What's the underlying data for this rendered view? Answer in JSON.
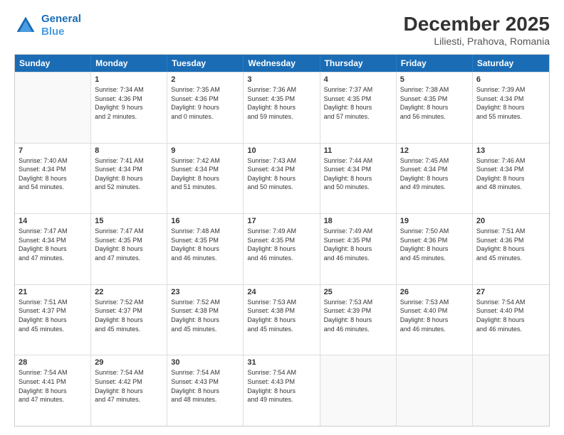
{
  "header": {
    "logo_line1": "General",
    "logo_line2": "Blue",
    "main_title": "December 2025",
    "subtitle": "Liliesti, Prahova, Romania"
  },
  "calendar": {
    "days": [
      "Sunday",
      "Monday",
      "Tuesday",
      "Wednesday",
      "Thursday",
      "Friday",
      "Saturday"
    ],
    "rows": [
      [
        {
          "day": "",
          "content": ""
        },
        {
          "day": "1",
          "content": "Sunrise: 7:34 AM\nSunset: 4:36 PM\nDaylight: 9 hours\nand 2 minutes."
        },
        {
          "day": "2",
          "content": "Sunrise: 7:35 AM\nSunset: 4:36 PM\nDaylight: 9 hours\nand 0 minutes."
        },
        {
          "day": "3",
          "content": "Sunrise: 7:36 AM\nSunset: 4:35 PM\nDaylight: 8 hours\nand 59 minutes."
        },
        {
          "day": "4",
          "content": "Sunrise: 7:37 AM\nSunset: 4:35 PM\nDaylight: 8 hours\nand 57 minutes."
        },
        {
          "day": "5",
          "content": "Sunrise: 7:38 AM\nSunset: 4:35 PM\nDaylight: 8 hours\nand 56 minutes."
        },
        {
          "day": "6",
          "content": "Sunrise: 7:39 AM\nSunset: 4:34 PM\nDaylight: 8 hours\nand 55 minutes."
        }
      ],
      [
        {
          "day": "7",
          "content": "Sunrise: 7:40 AM\nSunset: 4:34 PM\nDaylight: 8 hours\nand 54 minutes."
        },
        {
          "day": "8",
          "content": "Sunrise: 7:41 AM\nSunset: 4:34 PM\nDaylight: 8 hours\nand 52 minutes."
        },
        {
          "day": "9",
          "content": "Sunrise: 7:42 AM\nSunset: 4:34 PM\nDaylight: 8 hours\nand 51 minutes."
        },
        {
          "day": "10",
          "content": "Sunrise: 7:43 AM\nSunset: 4:34 PM\nDaylight: 8 hours\nand 50 minutes."
        },
        {
          "day": "11",
          "content": "Sunrise: 7:44 AM\nSunset: 4:34 PM\nDaylight: 8 hours\nand 50 minutes."
        },
        {
          "day": "12",
          "content": "Sunrise: 7:45 AM\nSunset: 4:34 PM\nDaylight: 8 hours\nand 49 minutes."
        },
        {
          "day": "13",
          "content": "Sunrise: 7:46 AM\nSunset: 4:34 PM\nDaylight: 8 hours\nand 48 minutes."
        }
      ],
      [
        {
          "day": "14",
          "content": "Sunrise: 7:47 AM\nSunset: 4:34 PM\nDaylight: 8 hours\nand 47 minutes."
        },
        {
          "day": "15",
          "content": "Sunrise: 7:47 AM\nSunset: 4:35 PM\nDaylight: 8 hours\nand 47 minutes."
        },
        {
          "day": "16",
          "content": "Sunrise: 7:48 AM\nSunset: 4:35 PM\nDaylight: 8 hours\nand 46 minutes."
        },
        {
          "day": "17",
          "content": "Sunrise: 7:49 AM\nSunset: 4:35 PM\nDaylight: 8 hours\nand 46 minutes."
        },
        {
          "day": "18",
          "content": "Sunrise: 7:49 AM\nSunset: 4:35 PM\nDaylight: 8 hours\nand 46 minutes."
        },
        {
          "day": "19",
          "content": "Sunrise: 7:50 AM\nSunset: 4:36 PM\nDaylight: 8 hours\nand 45 minutes."
        },
        {
          "day": "20",
          "content": "Sunrise: 7:51 AM\nSunset: 4:36 PM\nDaylight: 8 hours\nand 45 minutes."
        }
      ],
      [
        {
          "day": "21",
          "content": "Sunrise: 7:51 AM\nSunset: 4:37 PM\nDaylight: 8 hours\nand 45 minutes."
        },
        {
          "day": "22",
          "content": "Sunrise: 7:52 AM\nSunset: 4:37 PM\nDaylight: 8 hours\nand 45 minutes."
        },
        {
          "day": "23",
          "content": "Sunrise: 7:52 AM\nSunset: 4:38 PM\nDaylight: 8 hours\nand 45 minutes."
        },
        {
          "day": "24",
          "content": "Sunrise: 7:53 AM\nSunset: 4:38 PM\nDaylight: 8 hours\nand 45 minutes."
        },
        {
          "day": "25",
          "content": "Sunrise: 7:53 AM\nSunset: 4:39 PM\nDaylight: 8 hours\nand 46 minutes."
        },
        {
          "day": "26",
          "content": "Sunrise: 7:53 AM\nSunset: 4:40 PM\nDaylight: 8 hours\nand 46 minutes."
        },
        {
          "day": "27",
          "content": "Sunrise: 7:54 AM\nSunset: 4:40 PM\nDaylight: 8 hours\nand 46 minutes."
        }
      ],
      [
        {
          "day": "28",
          "content": "Sunrise: 7:54 AM\nSunset: 4:41 PM\nDaylight: 8 hours\nand 47 minutes."
        },
        {
          "day": "29",
          "content": "Sunrise: 7:54 AM\nSunset: 4:42 PM\nDaylight: 8 hours\nand 47 minutes."
        },
        {
          "day": "30",
          "content": "Sunrise: 7:54 AM\nSunset: 4:43 PM\nDaylight: 8 hours\nand 48 minutes."
        },
        {
          "day": "31",
          "content": "Sunrise: 7:54 AM\nSunset: 4:43 PM\nDaylight: 8 hours\nand 49 minutes."
        },
        {
          "day": "",
          "content": ""
        },
        {
          "day": "",
          "content": ""
        },
        {
          "day": "",
          "content": ""
        }
      ]
    ]
  }
}
